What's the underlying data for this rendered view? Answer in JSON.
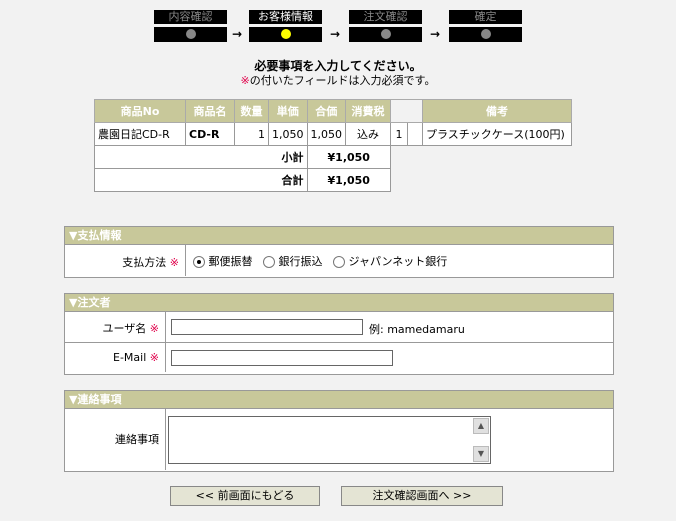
{
  "steps": [
    {
      "label": "内容確認",
      "active": false
    },
    {
      "label": "お客様情報",
      "active": true
    },
    {
      "label": "注文確認",
      "active": false
    },
    {
      "label": "確定",
      "active": false
    }
  ],
  "step_arrow": "→",
  "intro": {
    "title": "必要事項を入力してください。",
    "required_mark": "※",
    "required_note": "の付いたフィールドは入力必須です。"
  },
  "order_table": {
    "headers": [
      "商品No",
      "商品名",
      "数量",
      "単価",
      "合価",
      "消費税",
      "",
      "備考"
    ],
    "row": {
      "product_no": "農園日記CD-R",
      "product_name": "CD-R",
      "quantity": "1",
      "unit_price": "1,050",
      "total_price": "1,050",
      "tax": "込み",
      "qty2": "1",
      "note": "プラスチックケース(100円)"
    },
    "subtotal_label": "小計",
    "subtotal_value": "¥1,050",
    "total_label": "合計",
    "total_value": "¥1,050"
  },
  "payment": {
    "section_title": "▼支払情報",
    "label": "支払方法",
    "required_mark": "※",
    "options": [
      {
        "label": "郵便振替",
        "checked": true
      },
      {
        "label": "銀行振込",
        "checked": false
      },
      {
        "label": "ジャパンネット銀行",
        "checked": false
      }
    ]
  },
  "customer": {
    "section_title": "▼注文者",
    "username_label": "ユーザ名",
    "username_value": "",
    "username_example": "例: mamedamaru",
    "email_label": "E-Mail",
    "email_value": "",
    "required_mark": "※"
  },
  "contact": {
    "section_title": "▼連絡事項",
    "label": "連絡事項",
    "value": ""
  },
  "buttons": {
    "back": "<< 前画面にもどる",
    "next": "注文確認画面へ >>"
  }
}
